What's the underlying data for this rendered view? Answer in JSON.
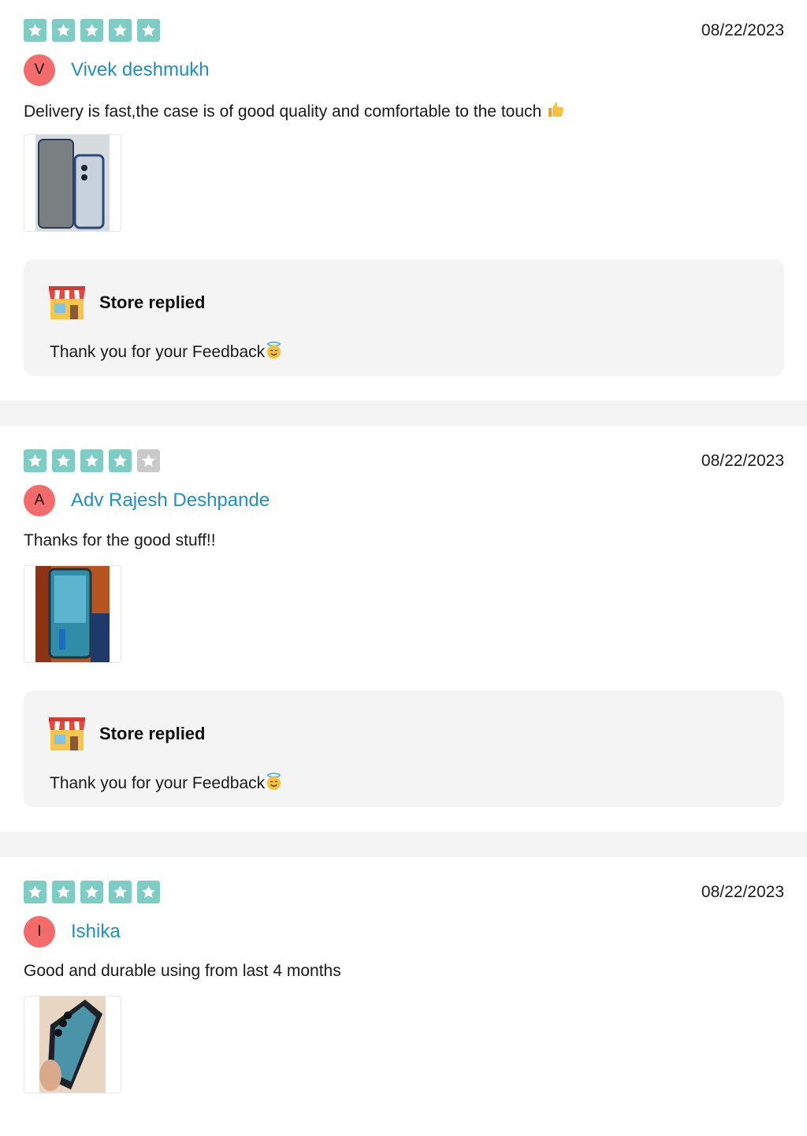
{
  "colors": {
    "star_filled": "#7dcdc4",
    "star_empty": "#c9c9c9",
    "author_link": "#1d8fcc",
    "avatar_bg": "#f36b6b",
    "reply_bg": "#f4f4f4"
  },
  "reviews": [
    {
      "rating": 5,
      "date": "08/22/2023",
      "avatar_letter": "V",
      "author": "Vivek deshmukh",
      "text": "Delivery is fast,the case is of good quality and comfortable to the touch",
      "text_emoji": "thumbs-up-icon",
      "reply": {
        "title": "Store replied",
        "text": "Thank you for your Feedback",
        "emoji": "halo-smile-icon"
      }
    },
    {
      "rating": 4,
      "date": "08/22/2023",
      "avatar_letter": "A",
      "author": "Adv Rajesh Deshpande",
      "text": "Thanks for the good stuff!!",
      "reply": {
        "title": "Store replied",
        "text": "Thank you for your Feedback",
        "emoji": "halo-smile-icon"
      }
    },
    {
      "rating": 5,
      "date": "08/22/2023",
      "avatar_letter": "I",
      "author": "Ishika",
      "text": "Good and durable using from last 4 months"
    }
  ]
}
